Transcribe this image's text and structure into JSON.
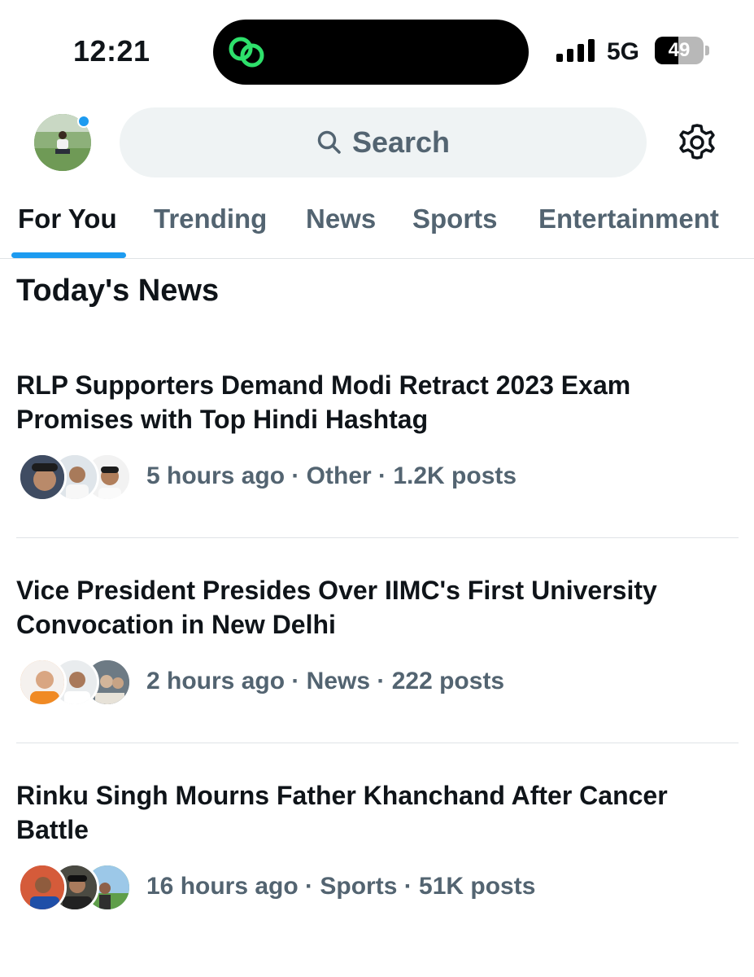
{
  "status_bar": {
    "time": "12:21",
    "network": "5G",
    "battery_percent": "49",
    "battery_level": 0.49,
    "signal_bars": 4,
    "island_icon": "link-icon",
    "island_icon_color": "#2ee06b"
  },
  "header": {
    "search": {
      "placeholder": "Search"
    },
    "avatar_icon": "profile-avatar",
    "settings_icon": "gear-icon",
    "notification_dot_color": "#1d9bf0"
  },
  "tabs": [
    {
      "label": "For You",
      "active": true
    },
    {
      "label": "Trending",
      "active": false
    },
    {
      "label": "News",
      "active": false
    },
    {
      "label": "Sports",
      "active": false
    },
    {
      "label": "Entertainment",
      "active": false
    }
  ],
  "section_title": "Today's News",
  "news": [
    {
      "headline": "RLP Supporters Demand Modi Retract 2023 Exam Promises with Top Hindi Hashtag",
      "meta": "5 hours ago · Other · 1.2K posts"
    },
    {
      "headline": "Vice President Presides Over IIMC's First University Convocation in New Delhi",
      "meta": "2 hours ago · News · 222 posts"
    },
    {
      "headline": "Rinku Singh Mourns Father Khanchand After Cancer Battle",
      "meta": "16 hours ago · Sports · 51K posts"
    }
  ],
  "colors": {
    "accent": "#1d9bf0",
    "text_primary": "#0f1419",
    "text_secondary": "#536471",
    "search_bg": "#eff3f4"
  }
}
